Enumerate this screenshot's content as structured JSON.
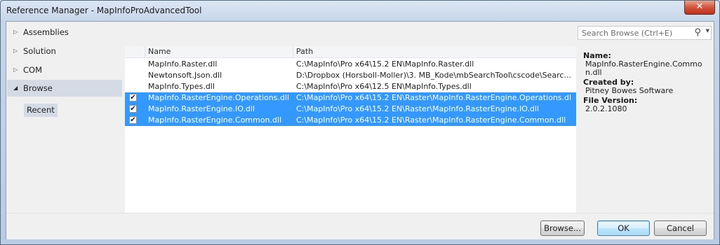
{
  "window": {
    "title": "Reference Manager - MapInfoProAdvancedTool",
    "close_glyph": "✕"
  },
  "nav": {
    "items": [
      {
        "label": "Assemblies",
        "arrow": "▷"
      },
      {
        "label": "Solution",
        "arrow": "▷"
      },
      {
        "label": "COM",
        "arrow": "▷"
      },
      {
        "label": "Browse",
        "arrow": "◢"
      }
    ],
    "sub_item": "Recent"
  },
  "search": {
    "placeholder": "Search Browse (Ctrl+E)",
    "icon": "search-icon",
    "dropdown_glyph": "▼"
  },
  "list": {
    "columns": [
      "Name",
      "Path"
    ],
    "rows": [
      {
        "checked": false,
        "name": "MapInfo.Raster.dll",
        "path": "C:\\MapInfo\\Pro x64\\15.2 EN\\MapInfo.Raster.dll"
      },
      {
        "checked": false,
        "name": "Newtonsoft.Json.dll",
        "path": "D:\\Dropbox (Horsboll-Moller)\\3. MB_Kode\\mbSearchTool\\cscode\\Searc..."
      },
      {
        "checked": false,
        "name": "MapInfo.Types.dll",
        "path": "C:\\MapInfo\\Pro x64\\12.5 EN\\MapInfo.Types.dll"
      },
      {
        "checked": true,
        "name": "MapInfo.RasterEngine.Operations.dll",
        "path": "C:\\MapInfo\\Pro x64\\15.2 EN\\Raster\\MapInfo.RasterEngine.Operations.dll"
      },
      {
        "checked": true,
        "name": "MapInfo.RasterEngine.IO.dll",
        "path": "C:\\MapInfo\\Pro x64\\15.2 EN\\Raster\\MapInfo.RasterEngine.IO.dll"
      },
      {
        "checked": true,
        "name": "MapInfo.RasterEngine.Common.dll",
        "path": "C:\\MapInfo\\Pro x64\\15.2 EN\\Raster\\MapInfo.RasterEngine.Common.dll"
      }
    ]
  },
  "details": {
    "name_label": "Name:",
    "name_value": "MapInfo.RasterEngine.Common.dll",
    "created_label": "Created by:",
    "created_value": "Pitney Bowes Software",
    "version_label": "File Version:",
    "version_value": "2.0.2.1080"
  },
  "buttons": {
    "browse": "Browse...",
    "ok": "OK",
    "cancel": "Cancel"
  }
}
